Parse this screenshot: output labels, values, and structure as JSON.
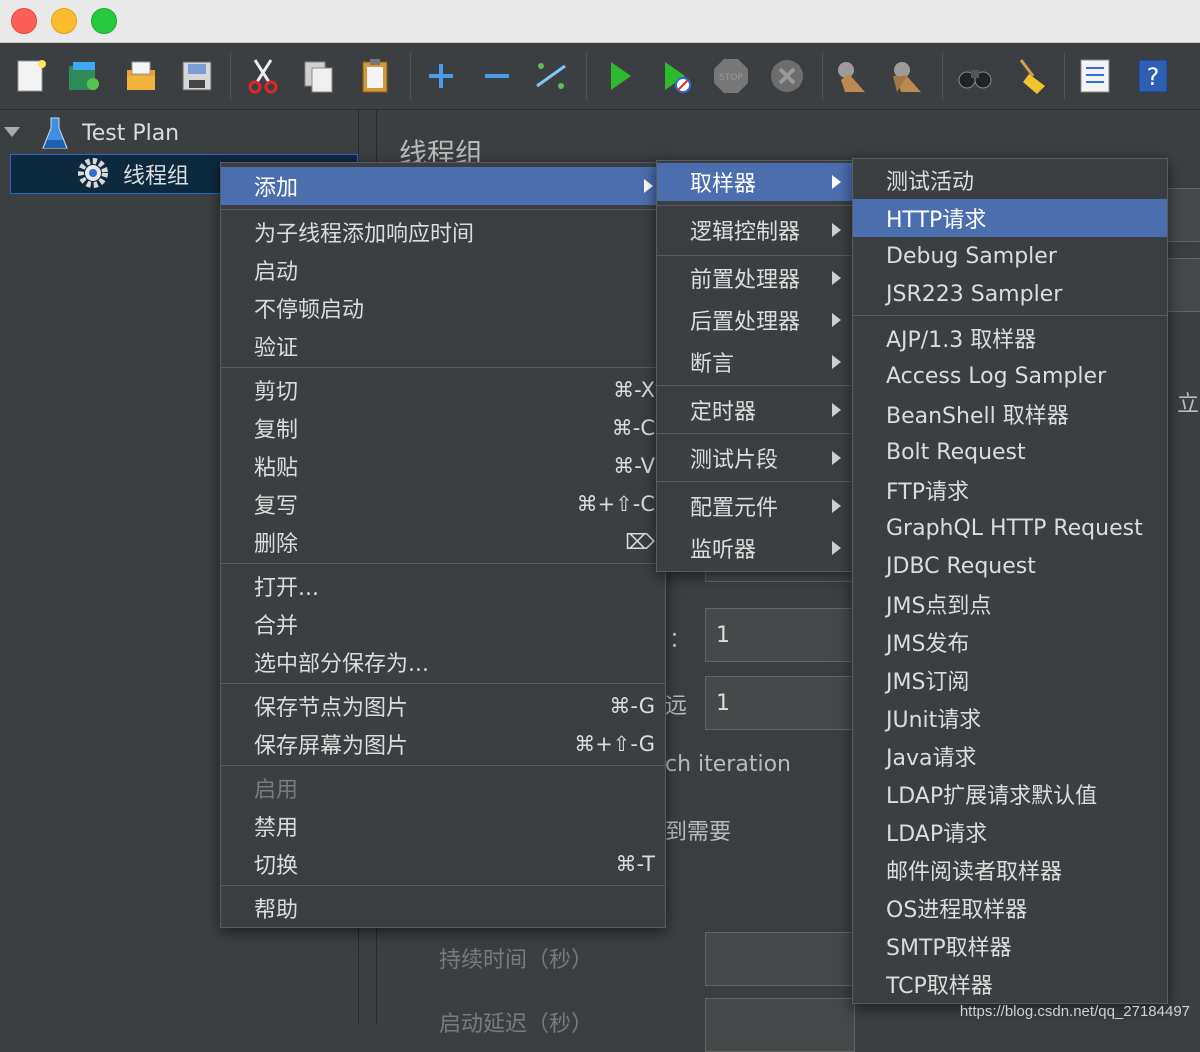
{
  "tree": {
    "items": [
      {
        "label": "Test Plan"
      },
      {
        "label": "线程组"
      }
    ]
  },
  "panel": {
    "title": "线程组",
    "field_values": [
      "1",
      "1"
    ],
    "partial_labels": [
      "：",
      "远",
      "ch iteration",
      "到需要",
      "立"
    ],
    "duration_label": "持续时间（秒）",
    "delay_label": "启动延迟（秒）"
  },
  "context_menu": {
    "items": [
      {
        "label": "添加",
        "shortcut": ""
      },
      {
        "label": "为子线程添加响应时间",
        "shortcut": ""
      },
      {
        "label": "启动",
        "shortcut": ""
      },
      {
        "label": "不停顿启动",
        "shortcut": ""
      },
      {
        "label": "验证",
        "shortcut": ""
      },
      {
        "label": "剪切",
        "shortcut": "⌘-X"
      },
      {
        "label": "复制",
        "shortcut": "⌘-C"
      },
      {
        "label": "粘贴",
        "shortcut": "⌘-V"
      },
      {
        "label": "复写",
        "shortcut": "⌘+⇧-C"
      },
      {
        "label": "删除",
        "shortcut": "⌦"
      },
      {
        "label": "打开...",
        "shortcut": ""
      },
      {
        "label": "合并",
        "shortcut": ""
      },
      {
        "label": "选中部分保存为...",
        "shortcut": ""
      },
      {
        "label": "保存节点为图片",
        "shortcut": "⌘-G"
      },
      {
        "label": "保存屏幕为图片",
        "shortcut": "⌘+⇧-G"
      },
      {
        "label": "启用",
        "shortcut": ""
      },
      {
        "label": "禁用",
        "shortcut": ""
      },
      {
        "label": "切换",
        "shortcut": "⌘-T"
      },
      {
        "label": "帮助",
        "shortcut": ""
      }
    ]
  },
  "add_submenu": {
    "items": [
      {
        "label": "取样器"
      },
      {
        "label": "逻辑控制器"
      },
      {
        "label": "前置处理器"
      },
      {
        "label": "后置处理器"
      },
      {
        "label": "断言"
      },
      {
        "label": "定时器"
      },
      {
        "label": "测试片段"
      },
      {
        "label": "配置元件"
      },
      {
        "label": "监听器"
      }
    ]
  },
  "sampler_submenu": {
    "items": [
      {
        "label": "测试活动"
      },
      {
        "label": "HTTP请求"
      },
      {
        "label": "Debug Sampler"
      },
      {
        "label": "JSR223 Sampler"
      },
      {
        "label": "AJP/1.3 取样器"
      },
      {
        "label": "Access Log Sampler"
      },
      {
        "label": "BeanShell 取样器"
      },
      {
        "label": "Bolt Request"
      },
      {
        "label": "FTP请求"
      },
      {
        "label": "GraphQL HTTP Request"
      },
      {
        "label": "JDBC Request"
      },
      {
        "label": "JMS点到点"
      },
      {
        "label": "JMS发布"
      },
      {
        "label": "JMS订阅"
      },
      {
        "label": "JUnit请求"
      },
      {
        "label": "Java请求"
      },
      {
        "label": "LDAP扩展请求默认值"
      },
      {
        "label": "LDAP请求"
      },
      {
        "label": "邮件阅读者取样器"
      },
      {
        "label": "OS进程取样器"
      },
      {
        "label": "SMTP取样器"
      },
      {
        "label": "TCP取样器"
      }
    ]
  },
  "watermark": "https://blog.csdn.net/qq_27184497",
  "colors": {
    "menu_highlight": "#4b6eaf",
    "background": "#3c3f41",
    "tree_selection": "#0d293e"
  }
}
